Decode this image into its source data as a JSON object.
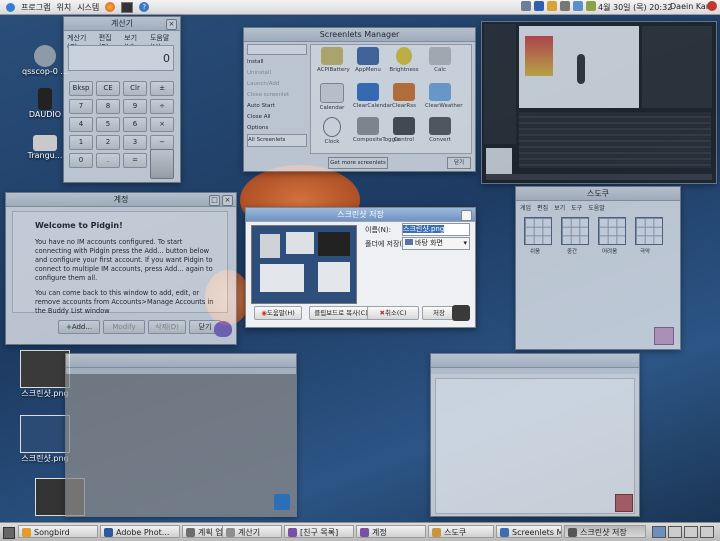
{
  "top_panel": {
    "menu": [
      "프로그램",
      "위치",
      "시스템"
    ],
    "date_time": "4월 30일 (목) 20:32",
    "user": "Daein Kang"
  },
  "desktop_icons": [
    {
      "label": "qsscop-0 ..."
    },
    {
      "label": "DAUDIO"
    },
    {
      "label": "Trangu..."
    },
    {
      "label": "스크린샷.png"
    },
    {
      "label": "스크린샷.png"
    }
  ],
  "calculator": {
    "title": "계산기",
    "menu": [
      "계산기(C)",
      "편집(E)",
      "보기(V)",
      "도움말(H)"
    ],
    "display": "0",
    "keys": [
      "Bksp",
      "CE",
      "Clr",
      "±",
      "7",
      "8",
      "9",
      "÷",
      "4",
      "5",
      "6",
      "×",
      "1",
      "2",
      "3",
      "−",
      "0",
      ".",
      "=",
      "+"
    ]
  },
  "screenlets": {
    "title": "Screenlets Manager",
    "sidebar": [
      "Install",
      "Uninstall",
      "Launch/Add",
      "Close screenlet",
      "Auto Start",
      "Close All",
      "Options",
      "All Screenlets"
    ],
    "items": [
      "ACPIBattery",
      "AppMenu",
      "Brightness",
      "Calc",
      "Calendar",
      "ClearCalendar",
      "ClearRss",
      "ClearWeather",
      "Clock",
      "CompositeToggle",
      "Control",
      "Convert"
    ],
    "get_more": "Get more screenlets",
    "close_label": "닫기"
  },
  "pidgin": {
    "title": "계정",
    "heading": "Welcome to Pidgin!",
    "para1": "You have no IM accounts configured. To start connecting with Pidgin press the Add... button below and configure your first account. If you want Pidgin to connect to multiple IM accounts, press Add... again to configure them all.",
    "para2": "You can come back to this window to add, edit, or remove accounts from Accounts>Manage Accounts in the Buddy List window",
    "buttons": [
      "Add...",
      "Modify",
      "삭제(D)",
      "닫기"
    ]
  },
  "screenshot_dialog": {
    "title": "스크린샷 저장",
    "name_label": "이름(N):",
    "name_value": "스크린샷.png",
    "folder_label": "폴더에 저장(F):",
    "folder_value": "바탕 화면",
    "buttons": [
      "도움말(H)",
      "클립보드로 복사(C)",
      "취소(C)",
      "저장"
    ]
  },
  "sudoku": {
    "title": "스도쿠",
    "menu": [
      "게임",
      "편집",
      "보기",
      "도구",
      "도움말"
    ],
    "puzzles": [
      "쉬움",
      "중간",
      "어려움",
      "극악"
    ]
  },
  "taskbar": [
    {
      "label": "Songbird",
      "color": "#e59a2c"
    },
    {
      "label": "Adobe Phot...",
      "color": "#2b5a9b"
    },
    {
      "label": "계획 업무...",
      "color": "#6d6d6d"
    },
    {
      "label": "계산기",
      "color": "#8e8e8e"
    },
    {
      "label": "[친구 목록]",
      "color": "#7b4fa3"
    },
    {
      "label": "계정",
      "color": "#7b4fa3"
    },
    {
      "label": "스도쿠",
      "color": "#c8963e"
    },
    {
      "label": "Screenlets M...",
      "color": "#3c6fb0"
    },
    {
      "label": "스크린샷 저장",
      "color": "#555"
    }
  ]
}
